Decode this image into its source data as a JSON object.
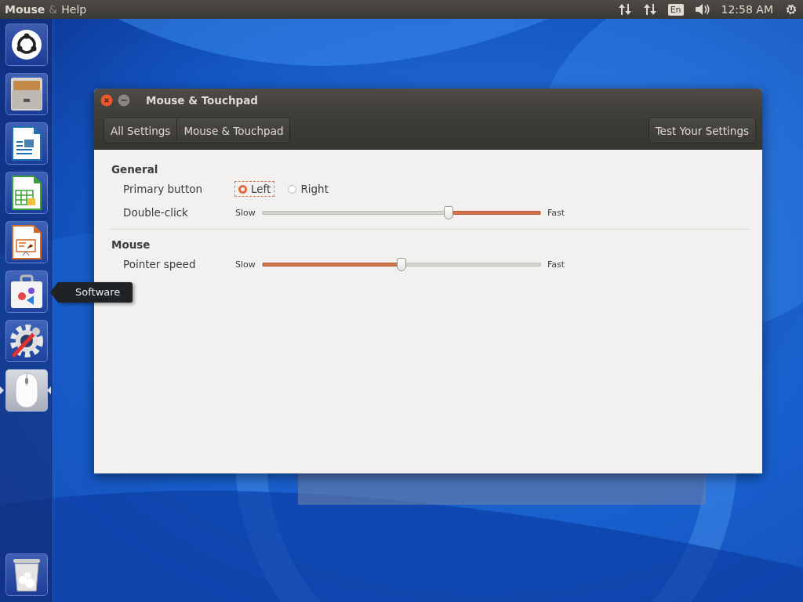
{
  "top_panel": {
    "app_title": "Mouse",
    "separator": "&",
    "menu": "Help",
    "keyboard": "En",
    "clock": "12:58 AM"
  },
  "launcher": {
    "items": [
      {
        "kind": "dash",
        "active": false
      },
      {
        "kind": "files",
        "active": false
      },
      {
        "kind": "writer",
        "active": false
      },
      {
        "kind": "calc",
        "active": false
      },
      {
        "kind": "impress",
        "active": false
      },
      {
        "kind": "software",
        "active": false
      },
      {
        "kind": "settings",
        "active": false
      },
      {
        "kind": "mouse",
        "active": true
      }
    ],
    "trash": {
      "kind": "trash",
      "active": false
    },
    "tooltip": "Software"
  },
  "window": {
    "title": "Mouse & Touchpad",
    "breadcrumbs": [
      "All Settings",
      "Mouse & Touchpad"
    ],
    "test_button": "Test Your Settings",
    "sections": [
      {
        "heading": "General",
        "rows": [
          {
            "kind": "radio",
            "label": "Primary button",
            "options": [
              {
                "label": "Left",
                "selected": true
              },
              {
                "label": "Right",
                "selected": false
              }
            ]
          },
          {
            "kind": "slider",
            "label": "Double-click",
            "min_label": "Slow",
            "max_label": "Fast",
            "level": 0.67,
            "inverted": true
          }
        ]
      },
      {
        "heading": "Mouse",
        "rows": [
          {
            "kind": "slider",
            "label": "Pointer speed",
            "min_label": "Slow",
            "max_label": "Fast",
            "level": 0.5,
            "inverted": false
          }
        ]
      }
    ]
  }
}
